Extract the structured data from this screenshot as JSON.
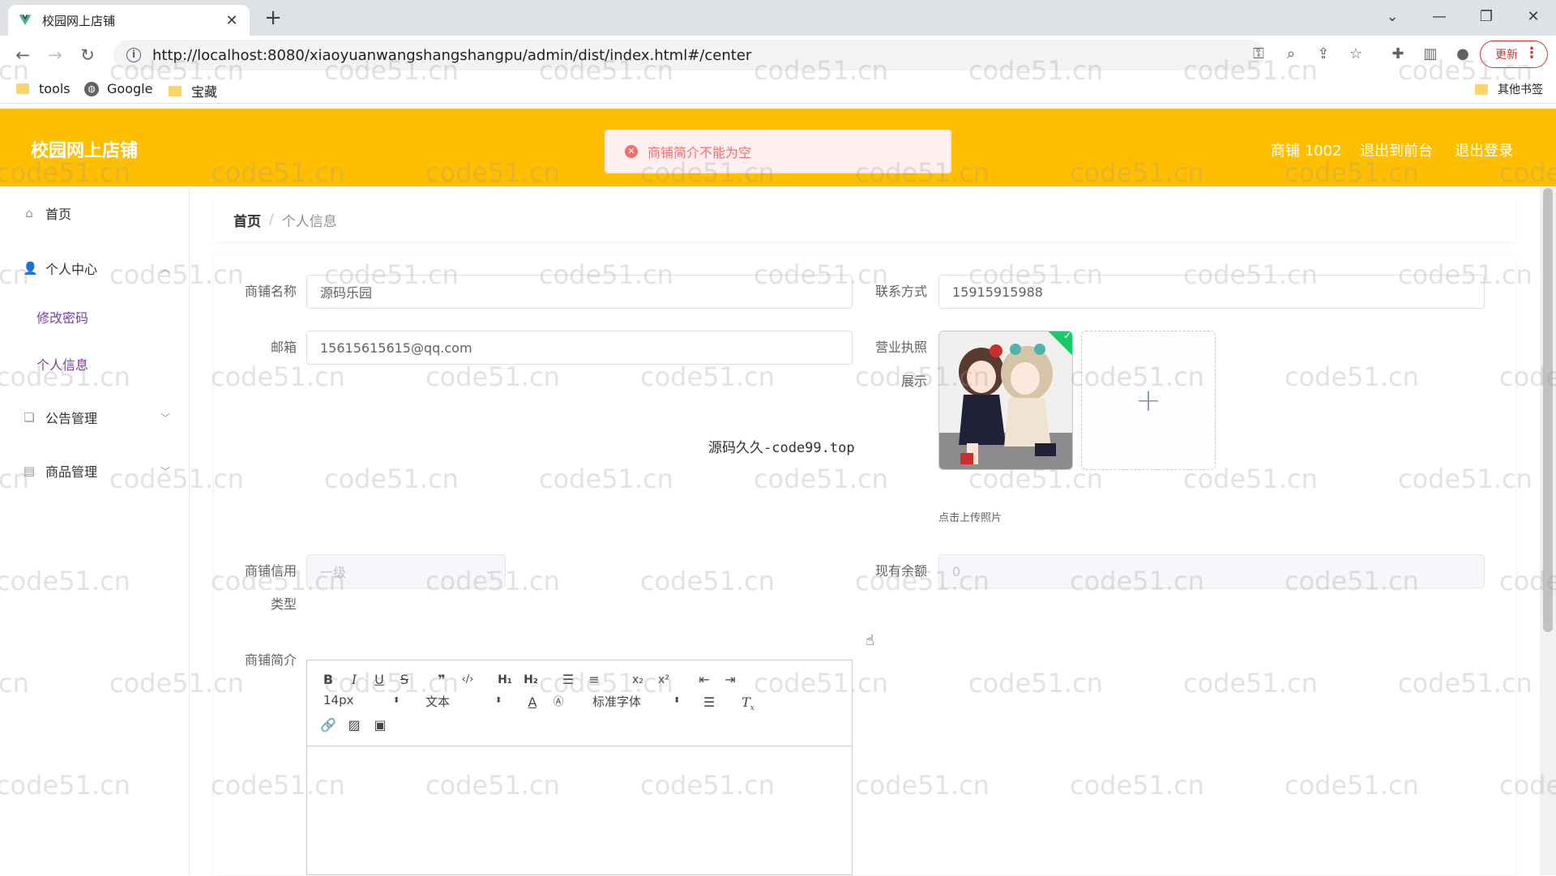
{
  "browser": {
    "tab_title": "校园网上店铺",
    "new_tab": "+",
    "url": "http://localhost:8080/xiaoyuanwangshangshangpu/admin/dist/index.html#/center",
    "update_label": "更新",
    "bookmarks": [
      "tools",
      "Google",
      "宝藏"
    ],
    "other_bookmarks": "其他书签"
  },
  "header": {
    "app_title": "校园网上店铺",
    "user_label": "商铺 1002",
    "back_to_front": "退出到前台",
    "logout": "退出登录"
  },
  "toast": {
    "message": "商铺简介不能为空",
    "color": "#f56c6c"
  },
  "sidebar": {
    "items": [
      {
        "label": "首页",
        "icon": "home-icon"
      },
      {
        "label": "个人中心",
        "icon": "user-icon"
      },
      {
        "label": "修改密码"
      },
      {
        "label": "个人信息"
      },
      {
        "label": "公告管理",
        "icon": "document-icon"
      },
      {
        "label": "商品管理",
        "icon": "shop-icon"
      }
    ]
  },
  "breadcrumb": {
    "home": "首页",
    "separator": "/",
    "current": "个人信息"
  },
  "form": {
    "shop_name_label": "商铺名称",
    "shop_name_value": "源码乐园",
    "contact_label": "联系方式",
    "contact_value": "15915915988",
    "email_label": "邮箱",
    "email_value": "15615615615@qq.com",
    "license_label_1": "营业执照",
    "license_label_2": "展示",
    "upload_tip": "点击上传照片",
    "credit_label_1": "商铺信用",
    "credit_label_2": "类型",
    "credit_value": "一级",
    "balance_label": "现有余额",
    "balance_value": "0",
    "intro_label": "商铺简介"
  },
  "note_text": "源码久久-code99.top",
  "editor": {
    "font_size": "14px",
    "header_picker": "文本",
    "font_family": "标准字体",
    "buttons": [
      "B",
      "I",
      "U",
      "S",
      "❞",
      "‹/›",
      "H1",
      "H2",
      "ol",
      "ul",
      "x₂",
      "x²",
      "outdent",
      "indent",
      "A",
      "bg",
      "align",
      "Tx",
      "link",
      "image",
      "video"
    ]
  },
  "watermark_text": "code51.cn",
  "colors": {
    "header": "#ffbf00",
    "submenu_text": "#7a3fa0",
    "error": "#f56c6c"
  }
}
